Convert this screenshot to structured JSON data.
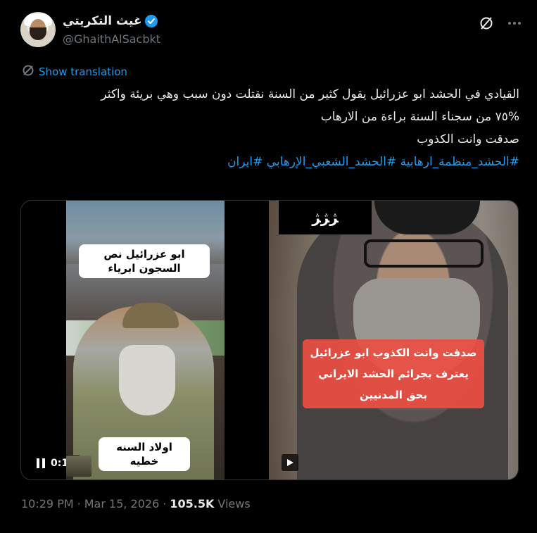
{
  "author": {
    "name": "غيث التكريتي",
    "handle": "@GhaithAlSacbkt",
    "verified": true
  },
  "tweet": {
    "translate_label": "Show translation",
    "lines": [
      "القيادي في الحشد ابو عزرائيل يقول كثير من السنة نقتلت دون سبب وهي بريئة واكثر",
      "%٧٥ من سجناء السنة براءة من الارهاب",
      "صدقت وانت الكذوب"
    ],
    "hashtags": "#الحشد_منظمة_ارهابية #الحشد_الشعبي_الإرهابي #ايران"
  },
  "media": {
    "left_caption_top": "ابو عزرائيل نص السجون ابرياء",
    "left_caption_bottom": "اولاد السنه خطيه",
    "right_caption": "صدقت وانت الكذوب ابو عزرائيل يعترف بجرائم الحشد الايراني بحق المدنيين",
    "right_logo": "ﮋﮋﮋ",
    "time": "0:14"
  },
  "meta": {
    "time": "10:29 PM",
    "separator1": "·",
    "date": "Mar 15, 2026",
    "separator2": "·",
    "views_count": "105.5K",
    "views_label": "Views"
  },
  "colors": {
    "background": "#000000",
    "link": "#1d9bf0",
    "muted": "#71767b",
    "text": "#e7e9ea"
  }
}
